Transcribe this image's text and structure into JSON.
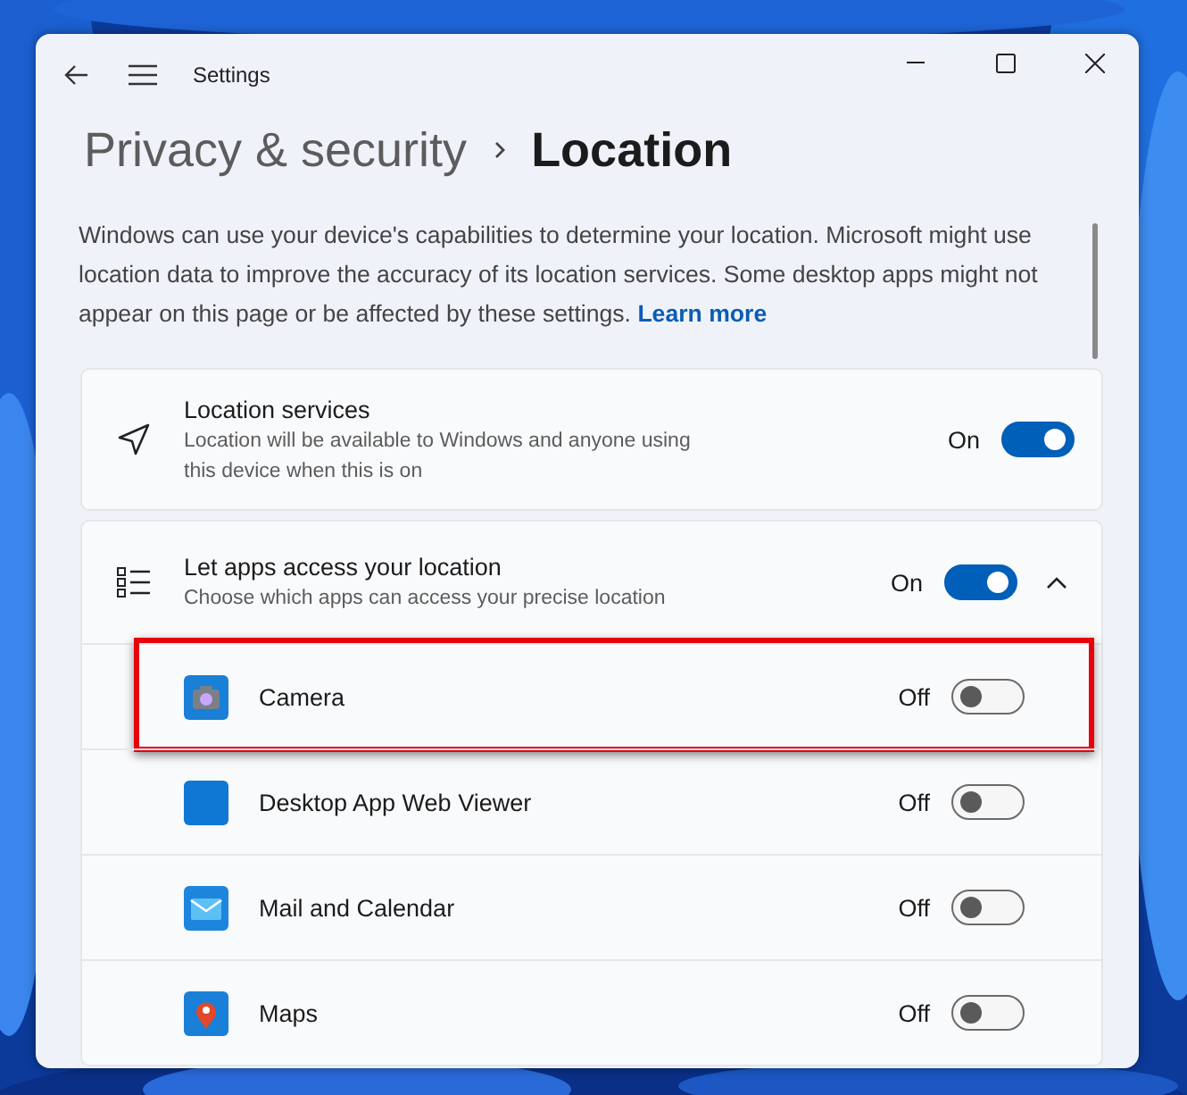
{
  "window": {
    "title": "Settings"
  },
  "breadcrumb": [
    {
      "label": "Privacy & security",
      "current": false
    },
    {
      "label": "Location",
      "current": true
    }
  ],
  "description": "Windows can use your device's capabilities to determine your location. Microsoft might use location data to improve the accuracy of its location services. Some desktop apps might not appear on this page or be affected by these settings.",
  "learn_more": "Learn more",
  "settings": [
    {
      "kind": "plain",
      "title": "Location services",
      "subtitle": "Location will be available to Windows and anyone using this device when this is on",
      "state_label": "On",
      "on": true
    },
    {
      "kind": "expander",
      "title": "Let apps access your location",
      "subtitle": "Choose which apps can access your precise location",
      "state_label": "On",
      "on": true,
      "expanded": true
    }
  ],
  "apps": [
    {
      "kind": "camera",
      "name": "Camera",
      "state_label": "Off",
      "on": false,
      "highlighted": true
    },
    {
      "kind": "blank",
      "name": "Desktop App Web Viewer",
      "state_label": "Off",
      "on": false,
      "highlighted": false
    },
    {
      "kind": "mail",
      "name": "Mail and Calendar",
      "state_label": "Off",
      "on": false,
      "highlighted": false
    },
    {
      "kind": "map",
      "name": "Maps",
      "state_label": "Off",
      "on": false,
      "highlighted": false
    }
  ]
}
